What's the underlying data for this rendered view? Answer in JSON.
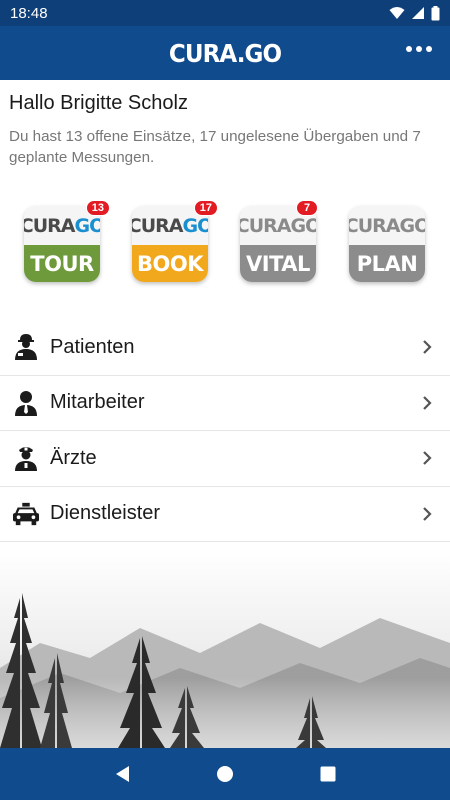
{
  "status_bar": {
    "time": "18:48",
    "icons": [
      "wifi-icon",
      "signal-icon",
      "battery-icon"
    ]
  },
  "app_bar": {
    "logo": "CURA.GO",
    "menu_icon": "more-horizontal-icon"
  },
  "greeting": "Hallo Brigitte Scholz",
  "summary": "Du hast 13 offene Einsätze, 17 ungelesene Übergaben und 7 geplante Messungen.",
  "apps": [
    {
      "brand_a": "CURA",
      "brand_b": "GO",
      "label": "TOUR",
      "badge": "13",
      "color": "#6f9a3b"
    },
    {
      "brand_a": "CURA",
      "brand_b": "GO",
      "label": "BOOK",
      "badge": "17",
      "color": "#f2a81d"
    },
    {
      "brand_a": "CURA",
      "brand_b": "GO",
      "label": "VITAL",
      "badge": "7",
      "color": "#8c8c8c"
    },
    {
      "brand_a": "CURA",
      "brand_b": "GO",
      "label": "PLAN",
      "badge": "",
      "color": "#8c8c8c"
    }
  ],
  "menu": [
    {
      "label": "Patienten",
      "icon": "patient-icon"
    },
    {
      "label": "Mitarbeiter",
      "icon": "employee-icon"
    },
    {
      "label": "Ärzte",
      "icon": "doctor-icon"
    },
    {
      "label": "Dienstleister",
      "icon": "taxi-icon"
    }
  ],
  "nav_bar": {
    "icons": [
      "back-icon",
      "home-icon",
      "recents-icon"
    ]
  },
  "colors": {
    "primary": "#0f4b8d",
    "status_bar": "#0f3f79",
    "badge": "#e31b23",
    "accent": "#1a8fd0"
  }
}
